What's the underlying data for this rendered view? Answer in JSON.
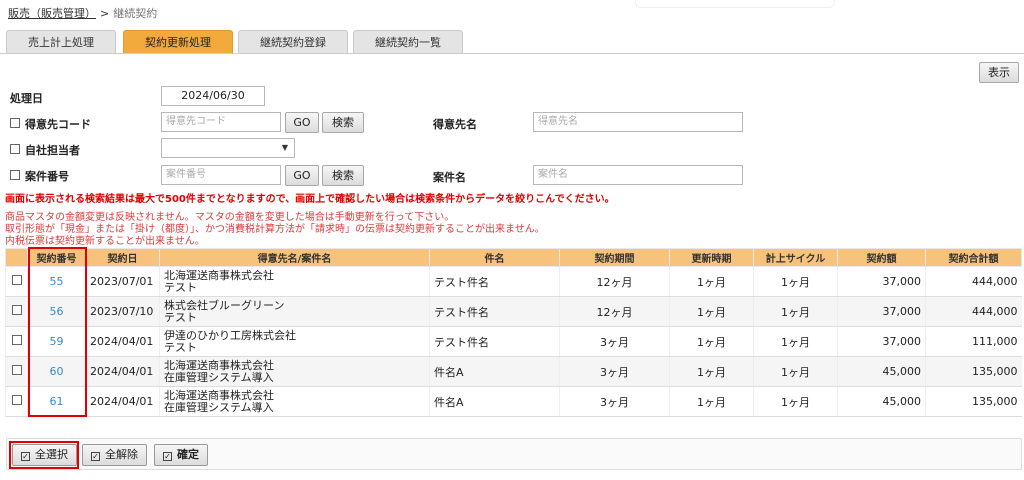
{
  "breadcrumb": {
    "parent": "販売（販売管理）",
    "separator": ">",
    "current": "継続契約"
  },
  "tabs": [
    {
      "label": "売上計上処理",
      "active": false
    },
    {
      "label": "契約更新処理",
      "active": true
    },
    {
      "label": "継続契約登録",
      "active": false
    },
    {
      "label": "継続契約一覧",
      "active": false
    }
  ],
  "toolbar": {
    "show_label": "表示"
  },
  "form": {
    "process_date_label": "処理日",
    "process_date_value": "2024/06/30",
    "customer_code_label": "得意先コード",
    "customer_code_placeholder": "得意先コード",
    "go_label": "GO",
    "search_label": "検索",
    "customer_name_label": "得意先名",
    "customer_name_placeholder": "得意先名",
    "staff_label": "自社担当者",
    "project_no_label": "案件番号",
    "project_no_placeholder": "案件番号",
    "project_name_label": "案件名",
    "project_name_placeholder": "案件名"
  },
  "notices": {
    "bold_warning": "画面に表示される検索結果は最大で500件までとなりますので、画面上で確認したい場合は検索条件からデータを絞りこんでください。",
    "line1": "商品マスタの金額変更は反映されません。マスタの金額を変更した場合は手動更新を行って下さい。",
    "line2": "取引形態が「現金」または「掛け（都度）」、かつ消費税計算方法が「請求時」の伝票は契約更新することが出来ません。",
    "line3": "内税伝票は契約更新することが出来ません。"
  },
  "table": {
    "headers": [
      "契約番号",
      "契約日",
      "得意先名/案件名",
      "件名",
      "契約期間",
      "更新時期",
      "計上サイクル",
      "契約額",
      "契約合計額"
    ],
    "rows": [
      {
        "no": "55",
        "date": "2023/07/01",
        "customer": "北海運送商事株式会社",
        "project": "テスト",
        "subject": "テスト件名",
        "period": "12ヶ月",
        "renewal": "1ヶ月",
        "cycle": "1ヶ月",
        "amount": "37,000",
        "total": "444,000"
      },
      {
        "no": "56",
        "date": "2023/07/10",
        "customer": "株式会社ブルーグリーン",
        "project": "テスト",
        "subject": "テスト件名",
        "period": "12ヶ月",
        "renewal": "1ヶ月",
        "cycle": "1ヶ月",
        "amount": "37,000",
        "total": "444,000"
      },
      {
        "no": "59",
        "date": "2024/04/01",
        "customer": "伊達のひかり工房株式会社",
        "project": "テスト",
        "subject": "テスト件名",
        "period": "3ヶ月",
        "renewal": "1ヶ月",
        "cycle": "1ヶ月",
        "amount": "37,000",
        "total": "111,000"
      },
      {
        "no": "60",
        "date": "2024/04/01",
        "customer": "北海運送商事株式会社",
        "project": "在庫管理システム導入",
        "subject": "件名A",
        "period": "3ヶ月",
        "renewal": "1ヶ月",
        "cycle": "1ヶ月",
        "amount": "45,000",
        "total": "135,000"
      },
      {
        "no": "61",
        "date": "2024/04/01",
        "customer": "北海運送商事株式会社",
        "project": "在庫管理システム導入",
        "subject": "件名A",
        "period": "3ヶ月",
        "renewal": "1ヶ月",
        "cycle": "1ヶ月",
        "amount": "45,000",
        "total": "135,000"
      }
    ]
  },
  "actions": {
    "select_all": "全選択",
    "deselect_all": "全解除",
    "confirm": "確定"
  },
  "colors": {
    "active_tab": "#f2aa3c",
    "table_header": "#f7c27c",
    "warning": "#e00000",
    "link": "#3a88c8"
  }
}
